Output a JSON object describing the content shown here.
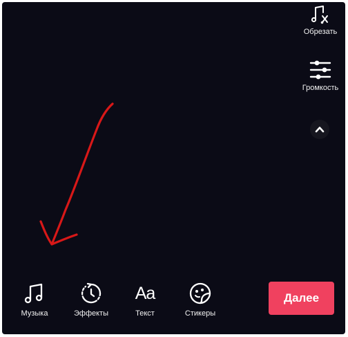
{
  "side_tools": {
    "trim": {
      "label": "Обрезать",
      "icon": "music-note-scissors-icon"
    },
    "volume": {
      "label": "Громкость",
      "icon": "sliders-icon"
    },
    "collapse": {
      "icon": "chevron-up-icon"
    }
  },
  "bottom_tools": {
    "music": {
      "label": "Музыка",
      "icon": "music-note-icon"
    },
    "effects": {
      "label": "Эффекты",
      "icon": "effects-timer-icon"
    },
    "text": {
      "label": "Текст",
      "glyph": "Aa",
      "icon": "text-icon"
    },
    "stickers": {
      "label": "Стикеры",
      "icon": "sticker-icon"
    }
  },
  "next_button": {
    "label": "Далее"
  },
  "colors": {
    "background": "#0b0b16",
    "accent": "#f0415f",
    "annotation": "#d81818",
    "text": "#ffffff"
  }
}
